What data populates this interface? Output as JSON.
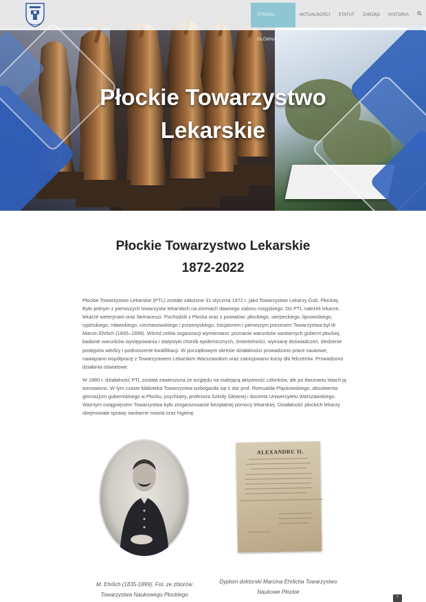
{
  "header": {
    "logo_icon": "ptl-crest-logo",
    "nav": [
      {
        "label": "Strona główna",
        "active": true
      },
      {
        "label": "Aktualności",
        "active": false
      },
      {
        "label": "Statut",
        "active": false
      },
      {
        "label": "Zarząd",
        "active": false
      },
      {
        "label": "Historia",
        "active": false
      }
    ],
    "search_icon": "search-icon"
  },
  "hero": {
    "title_line1": "Płockie Towarzystwo",
    "title_line2": "Lekarskie"
  },
  "main": {
    "heading_line1": "Płockie Towarzystwo Lekarskie",
    "heading_line2": "1872-2022",
    "paragraphs": [
      "Płockie Towarzystwo Lekarskie (PTL) zostało założone 31 stycznia 1872 r. jako Towarzystwo Lekarzy Gub. Płockiej. Było jednym z pierwszych towarzystw lekarskich na ziemiach dawnego zaboru rosyjskiego. Do PTL należeli lekarze, lekarze weterynarii oraz farmaceuci. Pochodzili z Płocka oraz z powiatów: płockiego, sierpeckiego, lipnowskiego, rypińskiego, mławskiego, ciechanowskiego i przasnyskiego. Inicjatorem i pierwszym prezesem Towarzystwa był dr Marcin Ehrlich (1835–1899). Wśród celów organizacji wymieniano: poznanie warunków sanitarnych guberni płockiej, badanie warunków występowania i statystyki chorób epidemicznych, śmiertelności, wymianę doświadczeń, śledzenie postępów wiedzy i podnoszenie kwalifikacji. W początkowym okresie działalności prowadzono prace naukowe, nawiązano współpracę z Towarzystwem Lekarskim Warszawskim oraz zainicjowano kursy dla felczerów. Prowadzono działania oświatowe.",
      "W 1880 r. działalność PTL została zawieszona ze względu na malejącą aktywność członków, ale po dwunastu latach ją wznowiono. W tym czasie biblioteka Towarzystwa wzbogaciła się o dar prof. Romualda Pląskowskiego, absolwenta gimnazjum gubernialnego w Płocku, psychiatry, profesora Szkoły Głównej i docenta Uniwersytetu Warszawskiego. Ważnym osiągnięciem Towarzystwa było zorganizowanie bezpłatnej pomocy lekarskiej. Działalność płockich lekarzy obejmowała sprawy sanitarne miasta oraz higienę."
    ]
  },
  "figures": [
    {
      "caption_line1": "M. Ehrlich (1835-1899). Fot. ze zbiorów",
      "caption_line2": "Towarzystwa Naukowego Płockiego"
    },
    {
      "document_heading": "ALEXANDRU II.",
      "caption_line1": "Dyplom doktorski Marcina Ehrlicha Towarzystwo",
      "caption_line2": "Naukowe Płockie"
    }
  ],
  "footer": {
    "scroll_top_icon": "chevron-up-icon",
    "scroll_top_label": "^"
  }
}
